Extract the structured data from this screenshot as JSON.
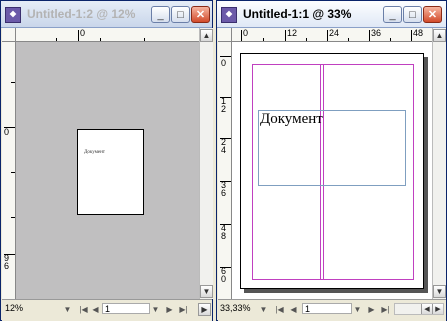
{
  "windows": [
    {
      "title": "Untitled-1:2 @ 12%",
      "active": false,
      "ruler_top_labels": [
        "0"
      ],
      "ruler_left_labels": [
        "0",
        "96"
      ],
      "zoom": "12%",
      "page_number": "1",
      "page_text": "Документ"
    },
    {
      "title": "Untitled-1:1 @ 33%",
      "active": true,
      "ruler_top_labels": [
        "0",
        "12",
        "24",
        "36",
        "48"
      ],
      "ruler_left_labels": [
        "0",
        "12",
        "24",
        "36",
        "48",
        "60"
      ],
      "zoom": "33,33%",
      "page_number": "1",
      "page_text": "Документ"
    }
  ],
  "icons": {
    "minimize": "minimize-icon",
    "maximize": "maximize-icon",
    "close": "close-icon"
  },
  "glyphs": {
    "minimize": "_",
    "maximize": "□",
    "close": "✕",
    "arrow_up": "▲",
    "arrow_down": "▼",
    "arrow_left": "◀",
    "arrow_right": "▶",
    "first": "|◀",
    "last": "▶|"
  },
  "colors": {
    "pasteboard": "#c0bfc0",
    "guide": "#c040c0",
    "frame": "#7f9fc0",
    "titlebar_inactive_text": "#b3b3b3"
  }
}
